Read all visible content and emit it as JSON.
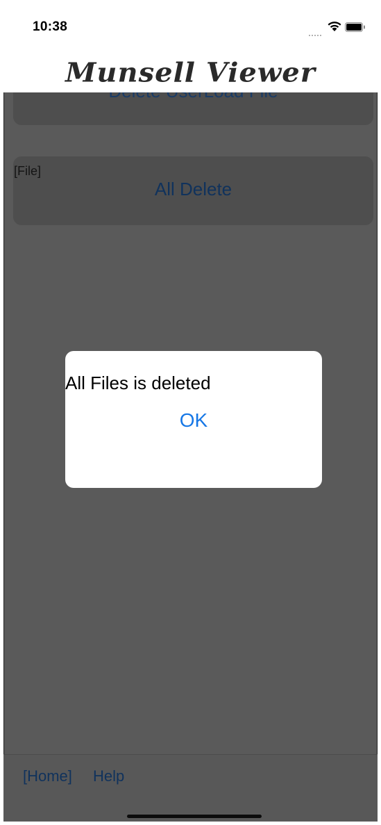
{
  "status_bar": {
    "time": "10:38",
    "wifi_icon": "wifi-icon",
    "battery_icon": "battery-icon"
  },
  "header": {
    "title": "Munsell Viewer"
  },
  "content": {
    "delete_userload_button": "Delete UserLoad File",
    "file_section_label": "[File]",
    "all_delete_button": "All Delete"
  },
  "alert": {
    "message": "All Files is deleted",
    "ok_label": "OK"
  },
  "bottom_bar": {
    "home_link": "[Home]",
    "help_link": "Help"
  },
  "colors": {
    "accent": "#1677e6",
    "overlay": "#5a5a5a",
    "dialog_bg": "#ffffff"
  }
}
